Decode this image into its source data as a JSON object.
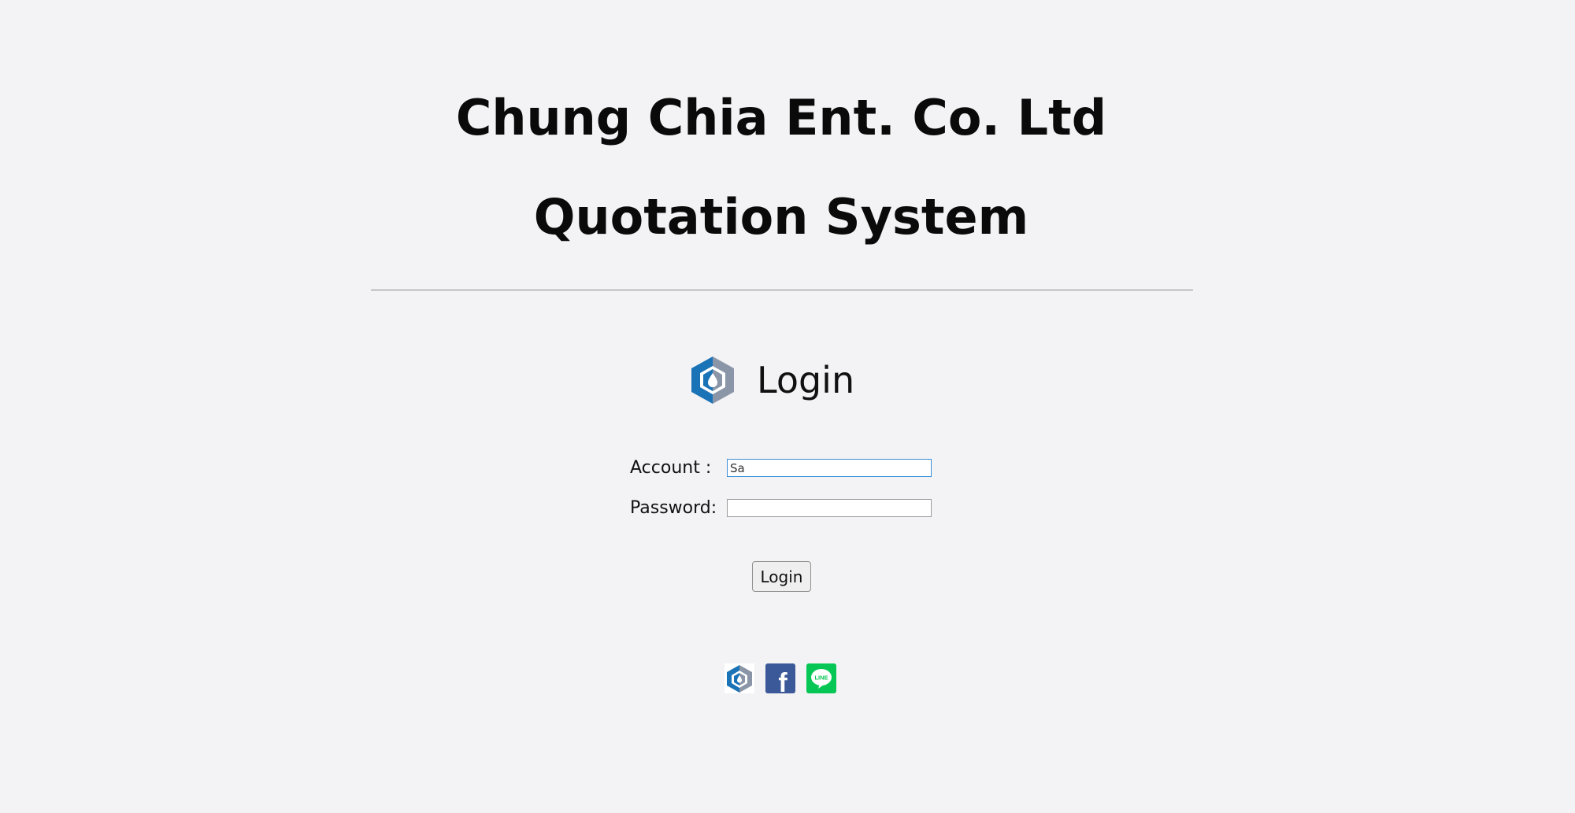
{
  "header": {
    "company": "Chung Chia Ent. Co. Ltd",
    "system": "Quotation System"
  },
  "login": {
    "title": "Login",
    "logo_icon": "hexagon-drop-logo-icon",
    "account_label": "Account :",
    "account_value": "Sa",
    "password_label": "Password:",
    "password_value": "",
    "button_label": "Login"
  },
  "social": {
    "items": [
      {
        "name": "company-logo-link",
        "icon": "hexagon-drop-icon"
      },
      {
        "name": "facebook-link",
        "icon": "facebook-icon",
        "text": "f"
      },
      {
        "name": "line-link",
        "icon": "line-icon",
        "text": "LINE"
      }
    ]
  },
  "colors": {
    "background": "#f3f2f4",
    "logo_blue": "#1a73b7",
    "logo_gray": "#8a96a8",
    "facebook_blue": "#3b5998",
    "line_green": "#06c755",
    "input_focus_border": "#3a8ed8"
  }
}
